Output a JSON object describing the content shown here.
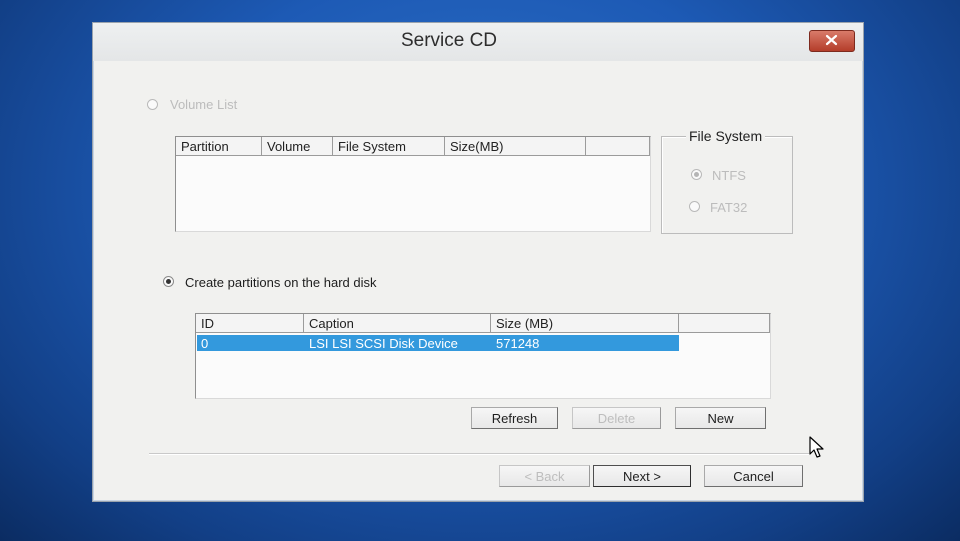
{
  "window": {
    "title": "Service CD",
    "close_icon": "close-x-icon"
  },
  "volume_list": {
    "radio_label": "Volume List",
    "selected": false,
    "enabled": false,
    "columns": [
      "Partition",
      "Volume",
      "File System",
      "Size(MB)",
      ""
    ]
  },
  "file_system": {
    "group_title": "File System",
    "options": [
      {
        "label": "NTFS",
        "selected": true,
        "enabled": false
      },
      {
        "label": "FAT32",
        "selected": false,
        "enabled": false
      }
    ]
  },
  "create_partitions": {
    "radio_label": "Create partitions on the hard disk",
    "selected": true
  },
  "disk_list": {
    "columns": [
      "ID",
      "Caption",
      "Size (MB)",
      ""
    ],
    "rows": [
      {
        "id": "0",
        "caption": "LSI LSI SCSI Disk Device",
        "size_mb": "571248",
        "selected": true
      }
    ]
  },
  "disk_buttons": {
    "refresh": "Refresh",
    "delete": "Delete",
    "new": "New"
  },
  "nav_buttons": {
    "back": "< Back",
    "next": "Next >",
    "cancel": "Cancel"
  },
  "colors": {
    "desktop": "#1d5ab5",
    "selection": "#3399dd",
    "close_button": "#c8503d"
  },
  "cursor_icon": "arrow-cursor-icon"
}
